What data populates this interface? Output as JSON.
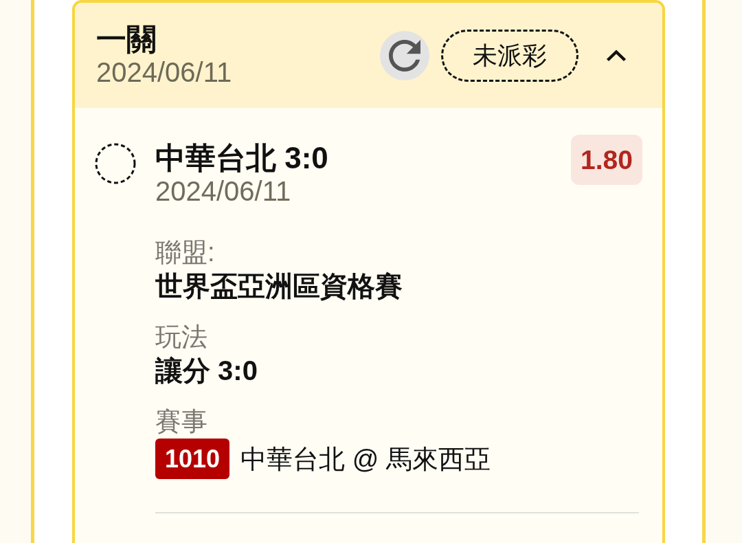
{
  "ticket": {
    "title": "一關",
    "date": "2024/06/11",
    "status": "未派彩",
    "expanded": true
  },
  "selection": {
    "title": "中華台北 3:0",
    "date": "2024/06/11",
    "odds": "1.80",
    "details": [
      {
        "kind": "text",
        "label": "聯盟:",
        "value": "世界盃亞洲區資格賽"
      },
      {
        "kind": "text",
        "label": "玩法",
        "value": "讓分 3:0"
      },
      {
        "kind": "match",
        "label": "賽事",
        "code": "1010",
        "value": "中華台北 @ 馬來西亞"
      }
    ]
  }
}
